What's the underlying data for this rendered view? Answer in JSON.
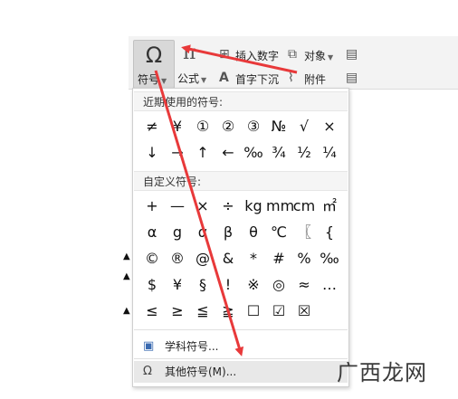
{
  "ribbon": {
    "symbol_icon": "Ω",
    "symbol_label": "符号",
    "formula_icon": "π",
    "formula_label": "公式",
    "insert_number_label": "插入数字",
    "object_label": "对象",
    "dropcap_label": "首字下沉",
    "attachment_label": "附件"
  },
  "panel": {
    "recent_title": "近期使用的符号:",
    "recent_symbols": [
      "≠",
      "¥",
      "①",
      "②",
      "③",
      "№",
      "√",
      "×",
      "↓",
      "→",
      "↑",
      "←",
      "‰",
      "¾",
      "½",
      "¼"
    ],
    "custom_title": "自定义符号:",
    "custom_symbols": [
      "+",
      "—",
      "×",
      "÷",
      "kg",
      "mm",
      "cm",
      "㎡",
      "α",
      "g",
      "α",
      "β",
      "θ",
      "℃",
      "〖",
      "{",
      "©",
      "®",
      "@",
      "&",
      "*",
      "#",
      "%",
      "‰",
      "$",
      "¥",
      "§",
      "!",
      "※",
      "◎",
      "≈",
      "…",
      "≤",
      "≥",
      "≦",
      "≧",
      "☐",
      "☑",
      "☒",
      ""
    ],
    "subject_symbols_label": "学科符号...",
    "other_symbols_label": "其他符号(M)..."
  },
  "icons": {
    "subject_icon": "book-icon",
    "other_icon": "omega-icon"
  },
  "watermark": "广西龙网",
  "colors": {
    "arrow": "#e8393a",
    "highlight": "#e8e8e8"
  }
}
